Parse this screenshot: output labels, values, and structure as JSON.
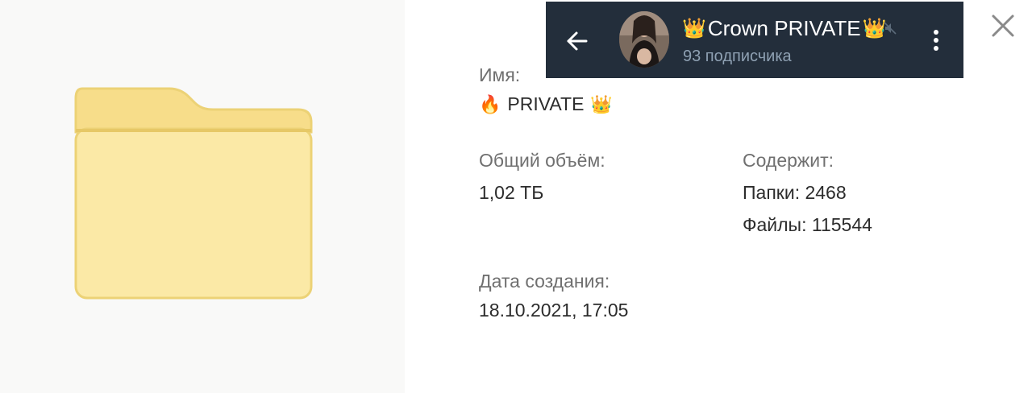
{
  "info": {
    "name_label": "Имя:",
    "name_value": "PRIVATE",
    "name_prefix_icon": "flame-emoji",
    "name_suffix_icon": "crown-emoji",
    "size_label": "Общий объём:",
    "size_value": "1,02 ТБ",
    "contains_label": "Содержит:",
    "folders_value": "Папки: 2468",
    "files_value": "Файлы: 115544",
    "created_label": "Дата создания:",
    "created_value": "18.10.2021, 17:05"
  },
  "channel_header": {
    "title": "Crown PRIVATE",
    "title_icon": "crown-emoji",
    "subtitle": "93 подписчика",
    "muted": true
  },
  "colors": {
    "folder_fill": "#fbe9a6",
    "folder_stroke": "#ecd276",
    "header_bg": "#232e3b"
  }
}
